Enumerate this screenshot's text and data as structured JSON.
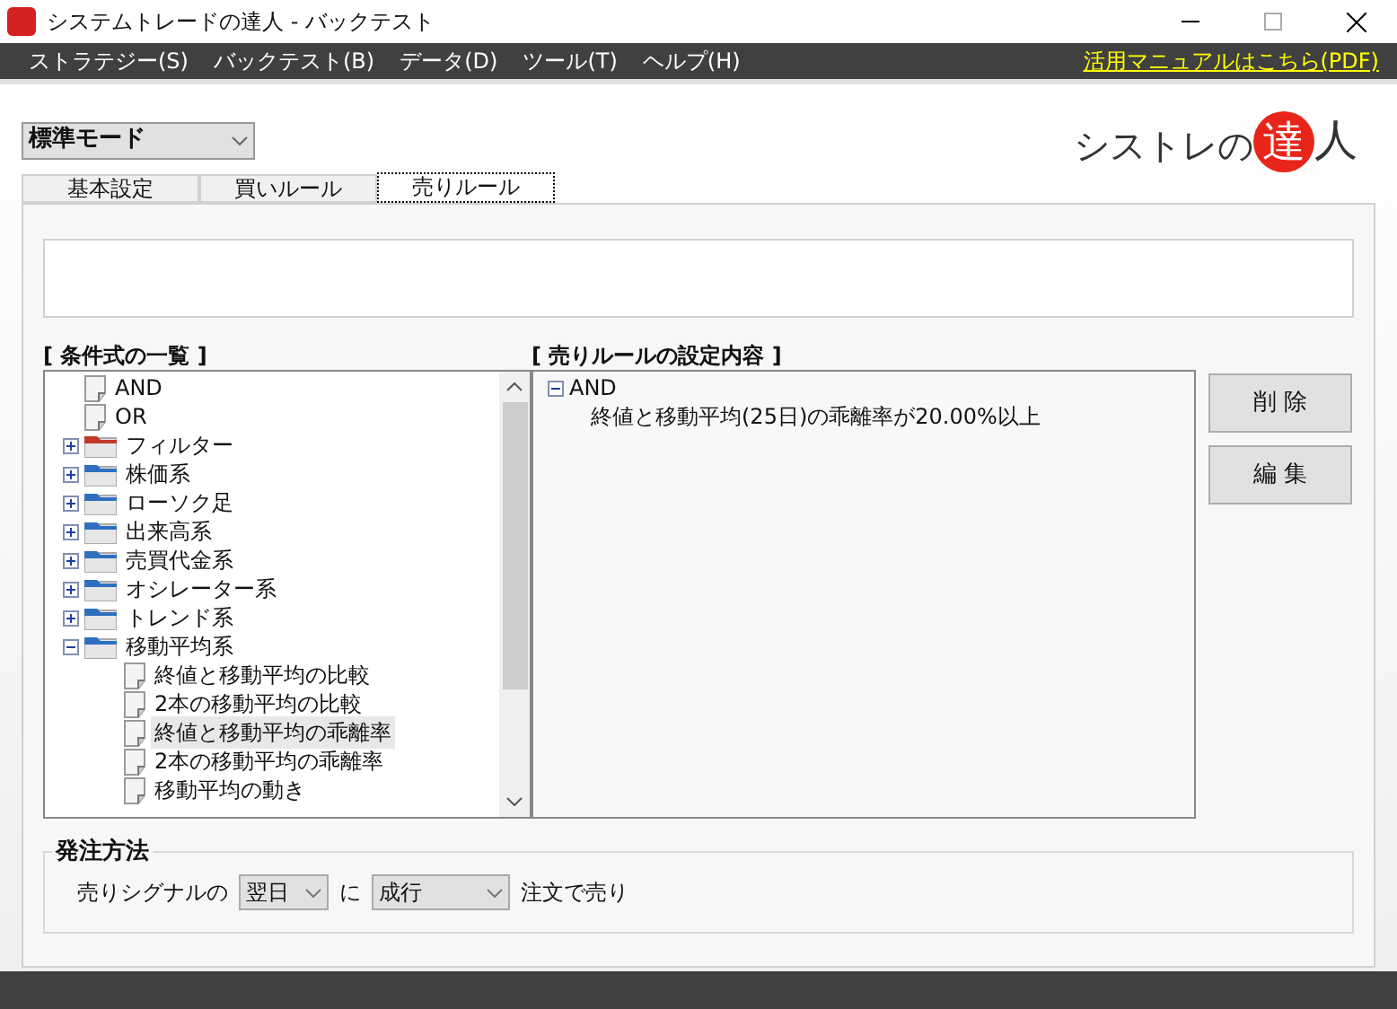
{
  "window": {
    "title": "システムトレードの達人 - バックテスト"
  },
  "menu": [
    "ストラテジー(S)",
    "バックテスト(B)",
    "データ(D)",
    "ツール(T)",
    "ヘルプ(H)"
  ],
  "manual_link": "活用マニュアルはこちら(PDF)",
  "mode_select": {
    "value": "標準モード"
  },
  "logo": {
    "text": "シストレの",
    "mark": "達",
    "tail": "人"
  },
  "tabs": [
    {
      "label": "基本設定",
      "selected": false
    },
    {
      "label": "買いルール",
      "selected": false
    },
    {
      "label": "売りルール",
      "selected": true
    }
  ],
  "condition_list": {
    "title": "[ 条件式の一覧 ]",
    "items": [
      {
        "label": "AND",
        "kind": "doc",
        "selected": false
      },
      {
        "label": "OR",
        "kind": "doc",
        "selected": false
      },
      {
        "label": "フィルター",
        "kind": "folder",
        "color": "#c0392b",
        "expanded": false,
        "selected": false
      },
      {
        "label": "株価系",
        "kind": "folder",
        "color": "#2f6fc0",
        "expanded": false,
        "selected": false
      },
      {
        "label": "ローソク足",
        "kind": "folder",
        "color": "#2f6fc0",
        "expanded": false,
        "selected": false
      },
      {
        "label": "出来高系",
        "kind": "folder",
        "color": "#2f6fc0",
        "expanded": false,
        "selected": false
      },
      {
        "label": "売買代金系",
        "kind": "folder",
        "color": "#2f6fc0",
        "expanded": false,
        "selected": false
      },
      {
        "label": "オシレーター系",
        "kind": "folder",
        "color": "#2f6fc0",
        "expanded": false,
        "selected": false
      },
      {
        "label": "トレンド系",
        "kind": "folder",
        "color": "#2f6fc0",
        "expanded": false,
        "selected": false
      },
      {
        "label": "移動平均系",
        "kind": "folder",
        "color": "#2f6fc0",
        "expanded": true,
        "selected": false,
        "children": [
          {
            "label": "終値と移動平均の比較",
            "kind": "doc",
            "selected": false
          },
          {
            "label": "2本の移動平均の比較",
            "kind": "doc",
            "selected": false
          },
          {
            "label": "終値と移動平均の乖離率",
            "kind": "doc",
            "selected": true
          },
          {
            "label": "2本の移動平均の乖離率",
            "kind": "doc",
            "selected": false
          },
          {
            "label": "移動平均の動き",
            "kind": "doc",
            "selected": false
          }
        ]
      }
    ]
  },
  "rule_settings": {
    "title": "[ 売りルールの設定内容 ]",
    "items": [
      {
        "label": "AND",
        "expanded": true,
        "children": [
          {
            "label": "終値と移動平均(25日)の乖離率が20.00%以上"
          }
        ]
      }
    ]
  },
  "buttons": [
    "削 除",
    "編 集"
  ],
  "order": {
    "title": "発注方法",
    "prefix": "売りシグナルの",
    "timing": "翌日",
    "mid": "に",
    "type": "成行",
    "suffix": "注文で売り"
  }
}
